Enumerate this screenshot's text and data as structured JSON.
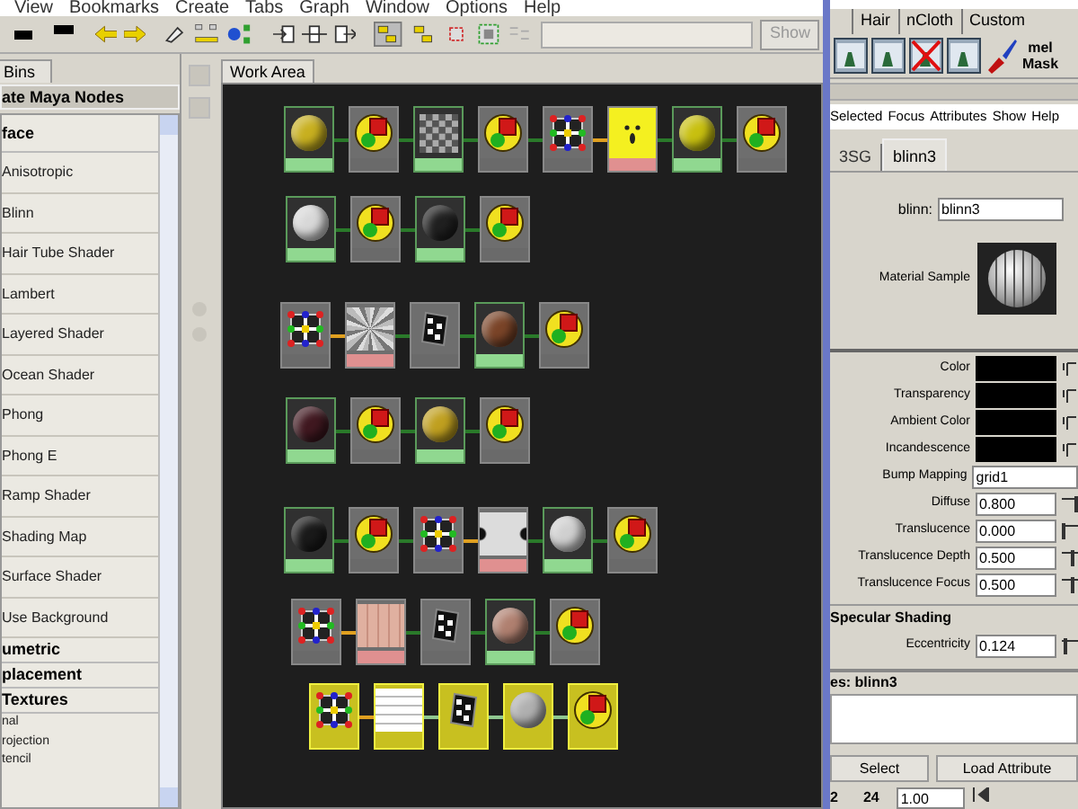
{
  "menu_bar": [
    "View",
    "Bookmarks",
    "Create",
    "Tabs",
    "Graph",
    "Window",
    "Options",
    "Help"
  ],
  "toolbar": {
    "show_button": "Show"
  },
  "bins_tab": "Bins",
  "create_panel": {
    "title": "ate Maya Nodes",
    "items": [
      {
        "kind": "header",
        "label": "face"
      },
      {
        "kind": "item",
        "label": "Anisotropic"
      },
      {
        "kind": "item",
        "label": "Blinn"
      },
      {
        "kind": "item",
        "label": "Hair Tube Shader"
      },
      {
        "kind": "item",
        "label": "Lambert"
      },
      {
        "kind": "item",
        "label": "Layered Shader"
      },
      {
        "kind": "item",
        "label": "Ocean Shader"
      },
      {
        "kind": "item",
        "label": "Phong"
      },
      {
        "kind": "item",
        "label": "Phong E"
      },
      {
        "kind": "item",
        "label": "Ramp Shader"
      },
      {
        "kind": "item",
        "label": "Shading Map"
      },
      {
        "kind": "item",
        "label": "Surface Shader"
      },
      {
        "kind": "item",
        "label": "Use Background"
      },
      {
        "kind": "header",
        "label": "umetric"
      },
      {
        "kind": "header",
        "label": "placement"
      },
      {
        "kind": "header",
        "label": "Textures"
      },
      {
        "kind": "small",
        "label": "nal"
      },
      {
        "kind": "small",
        "label": "rojection"
      },
      {
        "kind": "small",
        "label": "tencil"
      }
    ]
  },
  "work_area_tab": "Work Area",
  "graph": {
    "rows": [
      {
        "nodes": [
          {
            "kind": "material",
            "color": "#c8b020",
            "selected": false
          },
          {
            "kind": "shading-group",
            "selected": false
          },
          {
            "kind": "checker",
            "selected": false
          },
          {
            "kind": "shading-group",
            "selected": false
          },
          {
            "kind": "placement",
            "selected": false
          },
          {
            "kind": "bulge",
            "selected": false
          },
          {
            "kind": "material",
            "color": "#c8c010",
            "selected": false
          },
          {
            "kind": "shading-group",
            "selected": false
          }
        ]
      },
      {
        "nodes": [
          {
            "kind": "material",
            "color": "#d8d8d8",
            "selected": false
          },
          {
            "kind": "shading-group",
            "selected": false
          },
          {
            "kind": "material",
            "color": "#202020",
            "selected": false
          },
          {
            "kind": "shading-group",
            "selected": false
          }
        ]
      },
      {
        "nodes": [
          {
            "kind": "placement",
            "selected": false
          },
          {
            "kind": "fractal",
            "selected": false
          },
          {
            "kind": "bump",
            "selected": false
          },
          {
            "kind": "material",
            "color": "#7a4428",
            "selected": false
          },
          {
            "kind": "shading-group",
            "selected": false
          }
        ]
      },
      {
        "nodes": [
          {
            "kind": "material",
            "color": "#401820",
            "selected": false
          },
          {
            "kind": "shading-group",
            "selected": false
          },
          {
            "kind": "material",
            "color": "#c0a020",
            "selected": false
          },
          {
            "kind": "shading-group",
            "selected": false
          }
        ]
      },
      {
        "nodes": [
          {
            "kind": "material",
            "color": "#1a1a1a",
            "selected": false
          },
          {
            "kind": "shading-group",
            "selected": false
          },
          {
            "kind": "placement",
            "selected": false
          },
          {
            "kind": "ramp",
            "selected": false
          },
          {
            "kind": "material",
            "color": "#d0d0d0",
            "selected": false
          },
          {
            "kind": "shading-group",
            "selected": false
          }
        ]
      },
      {
        "nodes": [
          {
            "kind": "placement",
            "selected": false
          },
          {
            "kind": "plaid",
            "selected": false
          },
          {
            "kind": "bump",
            "selected": false
          },
          {
            "kind": "material",
            "color": "#b08070",
            "selected": false
          },
          {
            "kind": "shading-group",
            "selected": false
          }
        ]
      },
      {
        "nodes": [
          {
            "kind": "placement",
            "selected": true
          },
          {
            "kind": "grid",
            "selected": true
          },
          {
            "kind": "bump",
            "selected": true
          },
          {
            "kind": "material",
            "color": "#b0b0b0",
            "selected": true
          },
          {
            "kind": "shading-group",
            "selected": true
          }
        ]
      }
    ]
  },
  "shelf_tabs": [
    "Hair",
    "nCloth",
    "Custom"
  ],
  "shelf": {
    "mel_label": "mel",
    "mask_label": "Mask"
  },
  "editor_menu": [
    "Selected",
    "Focus",
    "Attributes",
    "Show",
    "Help"
  ],
  "editor_tabs": [
    {
      "label": "3SG",
      "selected": false
    },
    {
      "label": "blinn3",
      "selected": true
    }
  ],
  "node_name": {
    "label": "blinn:",
    "value": "blinn3"
  },
  "material_sample": "Material Sample",
  "attributes": [
    {
      "kind": "color",
      "label": "Color",
      "color": "#000000"
    },
    {
      "kind": "color",
      "label": "Transparency",
      "color": "#000000"
    },
    {
      "kind": "color",
      "label": "Ambient Color",
      "color": "#000000"
    },
    {
      "kind": "color",
      "label": "Incandescence",
      "color": "#000000"
    },
    {
      "kind": "text",
      "label": "Bump Mapping",
      "value": "grid1"
    },
    {
      "kind": "number",
      "label": "Diffuse",
      "value": "0.800",
      "level": 0.8
    },
    {
      "kind": "number",
      "label": "Translucence",
      "value": "0.000",
      "level": 0
    },
    {
      "kind": "number",
      "label": "Translucence Depth",
      "value": "0.500",
      "level": 0.5
    },
    {
      "kind": "number",
      "label": "Translucence Focus",
      "value": "0.500",
      "level": 0.5
    }
  ],
  "specular": {
    "title": "Specular Shading",
    "attributes": [
      {
        "label": "Eccentricity",
        "value": "0.124",
        "level": 0.12
      }
    ]
  },
  "notes": {
    "title": "es:  blinn3"
  },
  "buttons": [
    "Select",
    "Load Attribute"
  ],
  "timeline": {
    "start": "2",
    "end": "24",
    "field": "1.00"
  }
}
